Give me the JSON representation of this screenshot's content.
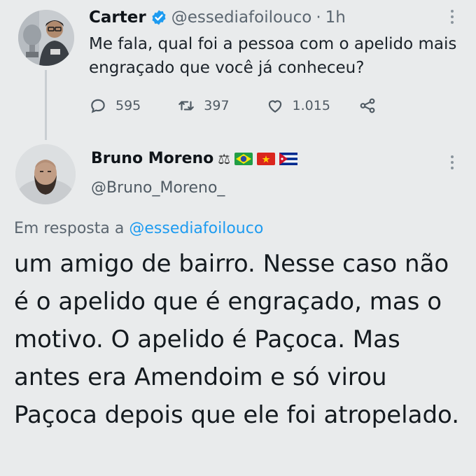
{
  "tweet": {
    "author_name": "Carter",
    "author_handle": "@essediafoilouco",
    "separator": "·",
    "time": "1h",
    "text": "Me fala, qual foi a pessoa com o apelido mais engraçado que você já conheceu?",
    "stats": {
      "replies": "595",
      "retweets": "397",
      "likes": "1.015"
    },
    "icons": [
      "reply-icon",
      "retweet-icon",
      "like-icon",
      "share-icon",
      "verified-icon",
      "more-icon"
    ]
  },
  "reply": {
    "author_name": "Bruno Moreno",
    "emoji": "⚖",
    "author_handle": "@Bruno_Moreno_",
    "reply_prefix": "Em resposta a",
    "reply_to": "@essediafoilouco",
    "text": "um amigo de bairro. Nesse caso não é o apelido que é engraçado, mas o motivo. O apelido é Paçoca. Mas antes era Amendoim e só virou Paçoca depois que ele foi atropelado.",
    "flags": [
      "brazil-flag",
      "vietnam-flag",
      "cuba-flag"
    ]
  },
  "colors": {
    "background": "#e9ebec",
    "link": "#1d9bf0",
    "verified": "#1d9bf0",
    "muted": "#5b6670"
  }
}
